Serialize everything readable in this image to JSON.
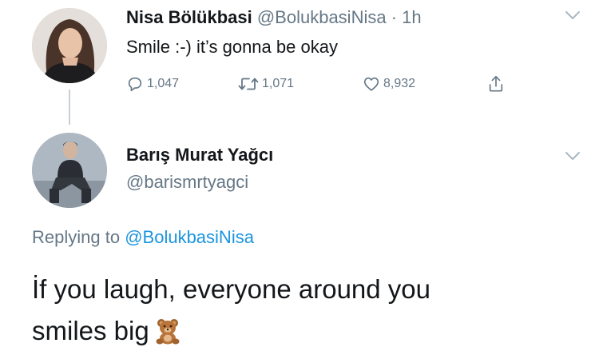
{
  "tweet": {
    "author_name": "Nisa Bölükbasi",
    "author_handle": "@BolukbasiNisa",
    "separator": "·",
    "time": "1h",
    "text": "Smile :-) it’s gonna be okay",
    "reply_count": "1,047",
    "retweet_count": "1,071",
    "like_count": "8,932",
    "icons": {
      "reply": "reply-icon",
      "retweet": "retweet-icon",
      "like": "heart-icon",
      "share": "share-icon",
      "more": "chevron-down-icon"
    }
  },
  "reply": {
    "author_name": "Barış Murat Yağcı",
    "author_handle": "@barismrtyagci",
    "replying_prefix": "Replying to",
    "replying_to": "@BolukbasiNisa",
    "text_line1": "İf you laugh, everyone around you",
    "text_line2": "smiles big",
    "emoji": "teddy-bear-icon"
  },
  "colors": {
    "text": "#14171a",
    "secondary": "#657786",
    "link": "#1b95e0",
    "background": "#ffffff"
  }
}
